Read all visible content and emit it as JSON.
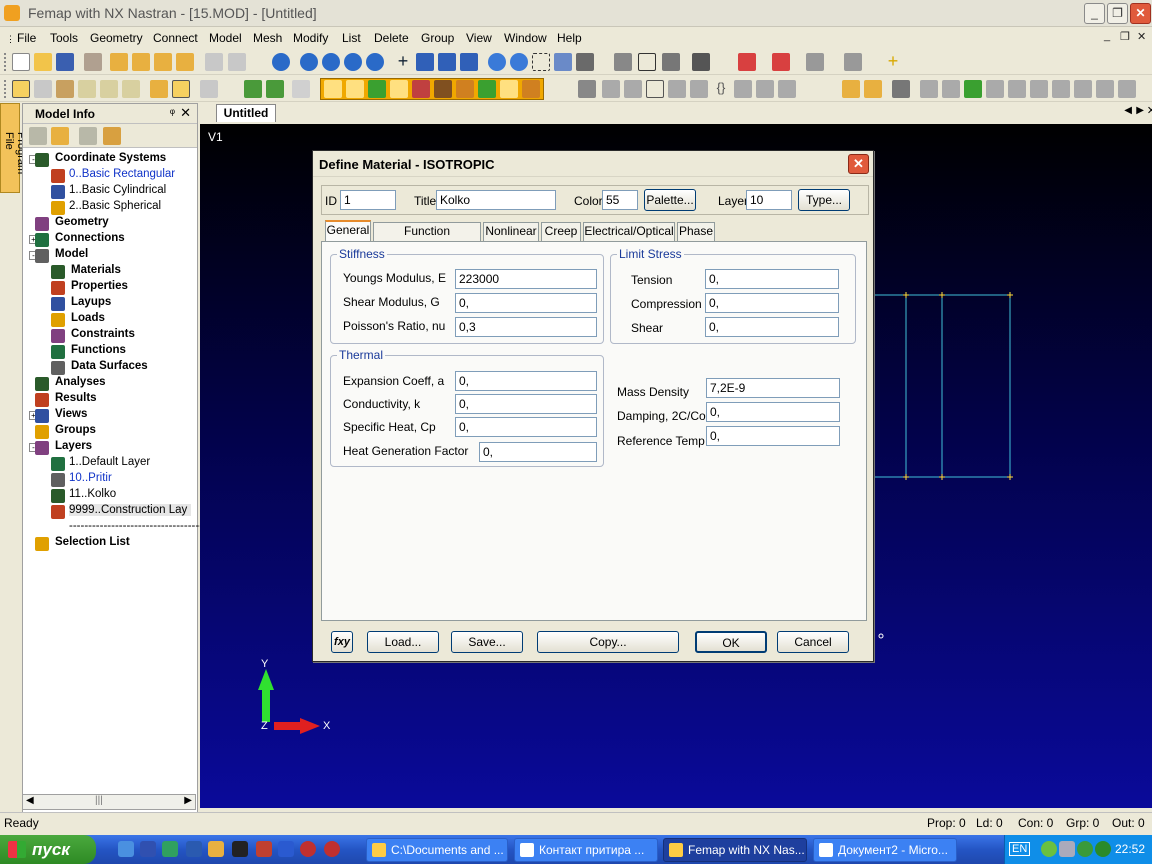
{
  "window": {
    "title": "Femap with NX Nastran - [15.MOD] - [Untitled]"
  },
  "menu": [
    "File",
    "Tools",
    "Geometry",
    "Connect",
    "Model",
    "Mesh",
    "Modify",
    "List",
    "Delete",
    "Group",
    "View",
    "Window",
    "Help"
  ],
  "left_strip_label": "Program File",
  "model_info": {
    "title": "Model Info",
    "tree": [
      {
        "label": "Coordinate Systems",
        "bold": true,
        "level": 0,
        "exp": "-"
      },
      {
        "label": "0..Basic Rectangular",
        "level": 1,
        "blue": true
      },
      {
        "label": "1..Basic Cylindrical",
        "level": 1
      },
      {
        "label": "2..Basic Spherical",
        "level": 1
      },
      {
        "label": "Geometry",
        "bold": true,
        "level": 0
      },
      {
        "label": "Connections",
        "bold": true,
        "level": 0,
        "exp": "+"
      },
      {
        "label": "Model",
        "bold": true,
        "level": 0,
        "exp": "-"
      },
      {
        "label": "Materials",
        "bold": true,
        "level": 1
      },
      {
        "label": "Properties",
        "bold": true,
        "level": 1
      },
      {
        "label": "Layups",
        "bold": true,
        "level": 1
      },
      {
        "label": "Loads",
        "bold": true,
        "level": 1
      },
      {
        "label": "Constraints",
        "bold": true,
        "level": 1
      },
      {
        "label": "Functions",
        "bold": true,
        "level": 1
      },
      {
        "label": "Data Surfaces",
        "bold": true,
        "level": 1
      },
      {
        "label": "Analyses",
        "bold": true,
        "level": 0
      },
      {
        "label": "Results",
        "bold": true,
        "level": 0
      },
      {
        "label": "Views",
        "bold": true,
        "level": 0,
        "exp": "+"
      },
      {
        "label": "Groups",
        "bold": true,
        "level": 0
      },
      {
        "label": "Layers",
        "bold": true,
        "level": 0,
        "exp": "-"
      },
      {
        "label": "1..Default Layer",
        "level": 1
      },
      {
        "label": "10..Pritir",
        "level": 1,
        "blue": true
      },
      {
        "label": "11..Kolko",
        "level": 1
      },
      {
        "label": "9999..Construction Lay",
        "level": 1,
        "selected": true
      },
      {
        "label": "------------------------------------",
        "level": 1
      },
      {
        "label": "Selection List",
        "bold": true,
        "level": 0
      }
    ]
  },
  "doc_tab": "Untitled",
  "view_label": "V1",
  "axes": {
    "y": "Y",
    "x": "X",
    "z": "Z"
  },
  "dialog": {
    "title": "Define Material - ISOTROPIC",
    "id_label": "ID",
    "id_value": "1",
    "title_label": "Title",
    "title_value": "Kolko",
    "color_label": "Color",
    "color_value": "55",
    "palette_btn": "Palette...",
    "layer_label": "Layer",
    "layer_value": "10",
    "type_btn": "Type...",
    "tabs": [
      "General",
      "Function References",
      "Nonlinear",
      "Creep",
      "Electrical/Optical",
      "Phase"
    ],
    "stiffness": {
      "label": "Stiffness",
      "youngs_label": "Youngs Modulus, E",
      "youngs": "223000",
      "shear_label": "Shear Modulus, G",
      "shear": "0,",
      "poisson_label": "Poisson's Ratio, nu",
      "poisson": "0,3"
    },
    "limit_stress": {
      "label": "Limit Stress",
      "tension_label": "Tension",
      "tension": "0,",
      "compression_label": "Compression",
      "compression": "0,",
      "shear_label": "Shear",
      "shear": "0,"
    },
    "thermal": {
      "label": "Thermal",
      "expansion_label": "Expansion Coeff, a",
      "expansion": "0,",
      "conductivity_label": "Conductivity, k",
      "conductivity": "0,",
      "specific_label": "Specific Heat, Cp",
      "specific": "0,",
      "heatgen_label": "Heat Generation Factor",
      "heatgen": "0,"
    },
    "mass_density_label": "Mass Density",
    "mass_density": "7,2E-9",
    "damping_label": "Damping, 2C/Co",
    "damping": "0,",
    "reftemp_label": "Reference Temp",
    "reftemp": "0,",
    "buttons": {
      "fxy": "fxy",
      "load": "Load...",
      "save": "Save...",
      "copy": "Copy...",
      "ok": "OK",
      "cancel": "Cancel"
    }
  },
  "status": {
    "ready": "Ready",
    "prop": "Prop: 0",
    "ld": "Ld: 0",
    "con": "Con: 0",
    "grp": "Grp: 0",
    "out": "Out: 0"
  },
  "taskbar": {
    "start": "пуск",
    "tasks": [
      "C:\\Documents and ...",
      "Контакт притира ...",
      "Femap with NX Nas...",
      "Документ2 - Micro..."
    ],
    "lang": "EN",
    "clock": "22:52"
  }
}
